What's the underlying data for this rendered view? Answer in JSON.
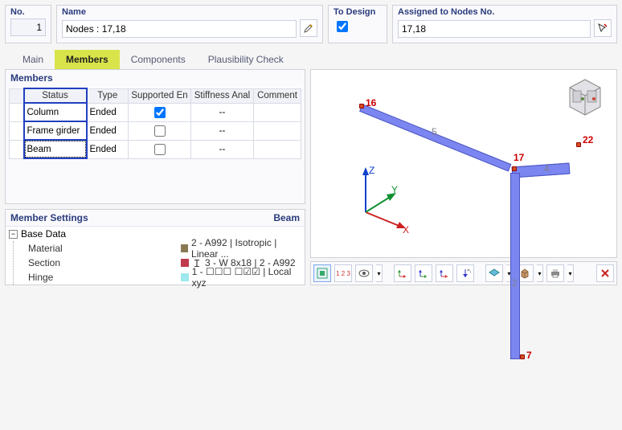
{
  "header": {
    "no_label": "No.",
    "no_value": "1",
    "name_label": "Name",
    "name_value": "Nodes : 17,18",
    "to_design_label": "To Design",
    "assigned_label": "Assigned to Nodes No.",
    "assigned_value": "17,18"
  },
  "tabs": {
    "main": "Main",
    "members": "Members",
    "components": "Components",
    "plaus": "Plausibility Check"
  },
  "members_panel": {
    "title": "Members",
    "cols": {
      "status": "Status",
      "type": "Type",
      "supported": "Supported En",
      "stiff": "Stiffness Anal",
      "comment": "Comment"
    },
    "rows": [
      {
        "status": "Column",
        "type": "Ended",
        "supported": true,
        "stiff": "--",
        "comment": ""
      },
      {
        "status": "Frame girder",
        "type": "Ended",
        "supported": false,
        "stiff": "--",
        "comment": ""
      },
      {
        "status": "Beam",
        "type": "Ended",
        "supported": false,
        "stiff": "--",
        "comment": ""
      }
    ]
  },
  "settings_panel": {
    "title": "Member Settings",
    "context": "Beam",
    "base_group": "Base Data",
    "rows": {
      "material_k": "Material",
      "material_v": "2 - A992 | Isotropic | Linear ...",
      "section_k": "Section",
      "section_v": "3 - W 8x18 | 2 - A992",
      "hinge_k": "Hinge",
      "hinge_v": "1 - ☐☐☐ ☐☑☑ | Local xyz"
    },
    "swatches": {
      "material": "#8a7a54",
      "section": "#c0394c",
      "hinge": "#9fe8ee"
    }
  },
  "viewport": {
    "nodes": {
      "n16": "16",
      "n17": "17",
      "n22": "22",
      "n7": "7"
    },
    "members": {
      "m5": "5",
      "m4": "4",
      "m2": "2"
    },
    "axes": {
      "x": "X",
      "y": "Y",
      "z": "Z"
    }
  },
  "toolbar_icons": {
    "fit": "fit-view",
    "num": "numbering",
    "show": "show-hide",
    "ax": "xy-axes",
    "ay": "yz-axes",
    "az": "xz-axes",
    "neg": "neg-z",
    "view": "view-mode",
    "render": "render-mode",
    "print": "print",
    "close": "close"
  }
}
